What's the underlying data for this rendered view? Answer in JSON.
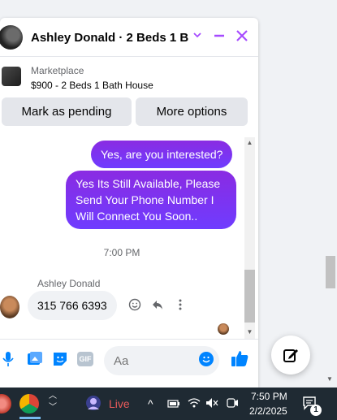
{
  "header": {
    "title": "Ashley Donald · 2 Beds 1 B...",
    "icons": [
      "chevron-down-icon",
      "minimize-icon",
      "close-icon"
    ]
  },
  "marketplace": {
    "label": "Marketplace",
    "listing": "$900 - 2 Beds 1 Bath House"
  },
  "actions": {
    "pending_label": "Mark as pending",
    "more_label": "More options"
  },
  "messages": {
    "out_1": "Yes, are you interested?",
    "out_2_line1": "Yes Its Still Available, Please",
    "out_2_line2": "Send Your Phone Number I",
    "out_2_line3": "Will Connect You Soon..",
    "timestamp": "7:00 PM",
    "sender_name": "Ashley Donald",
    "in_1": "315 766 6393"
  },
  "composer": {
    "placeholder": "Aa",
    "gif_label": "GIF"
  },
  "taskbar": {
    "live_label": "Live",
    "time": "7:50 PM",
    "date": "2/2/2025",
    "notification_count": "1"
  },
  "colors": {
    "accent": "#a64bff",
    "bubble_out": "#7a35f0",
    "messenger_blue": "#0084ff",
    "taskbar": "#1f2a33"
  }
}
